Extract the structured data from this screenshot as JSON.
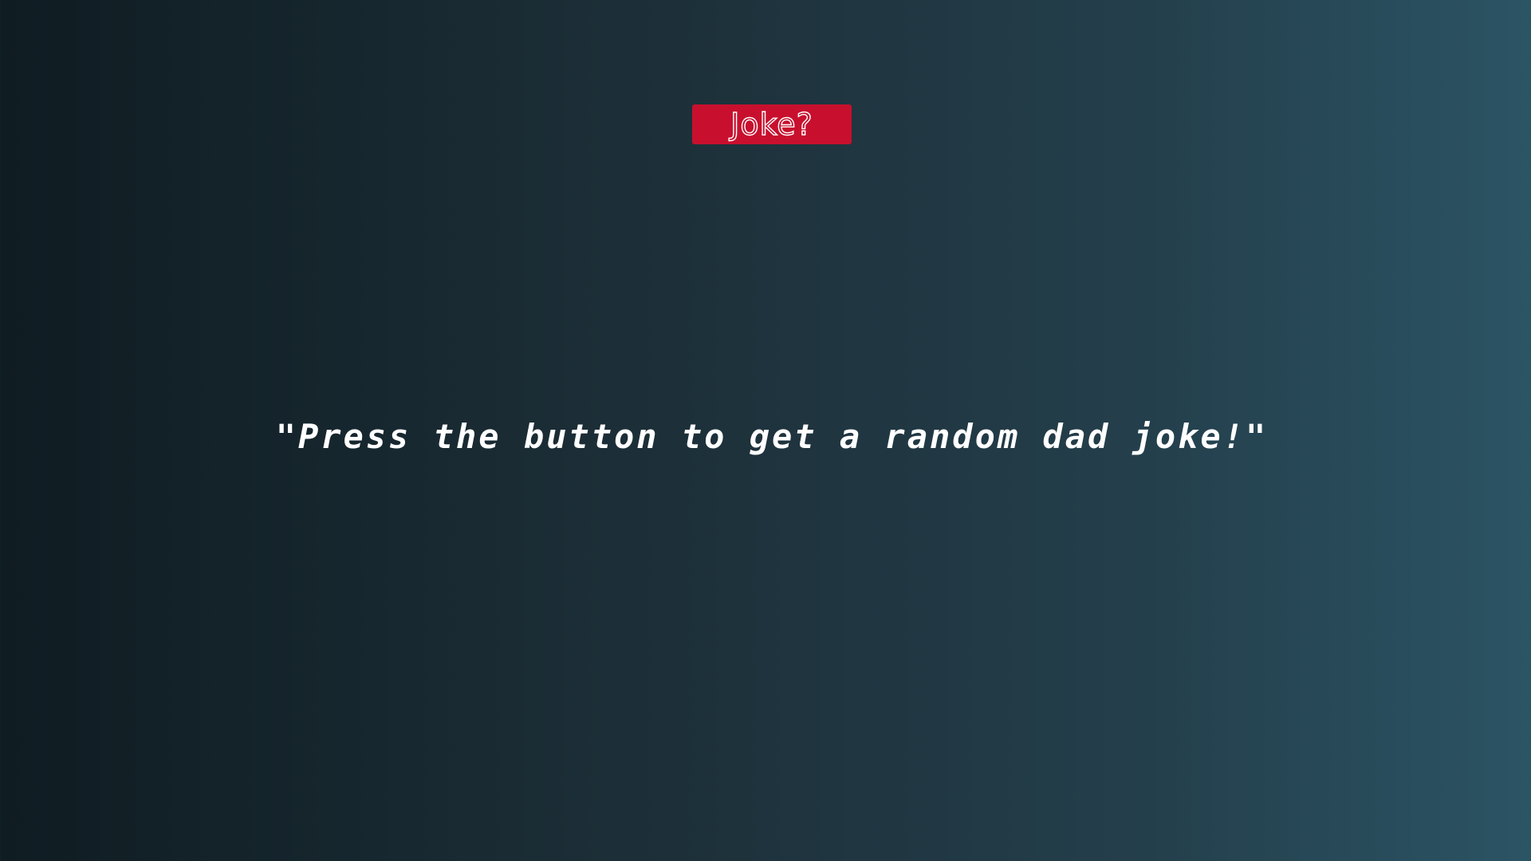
{
  "joke_button": {
    "label": "Joke?"
  },
  "joke": {
    "text": "\"Press the button to get a random dad joke!\""
  },
  "colors": {
    "button_background": "#c8102e",
    "text": "#ffffff",
    "gradient_start": "#0f1c22",
    "gradient_end": "#2b5464"
  }
}
